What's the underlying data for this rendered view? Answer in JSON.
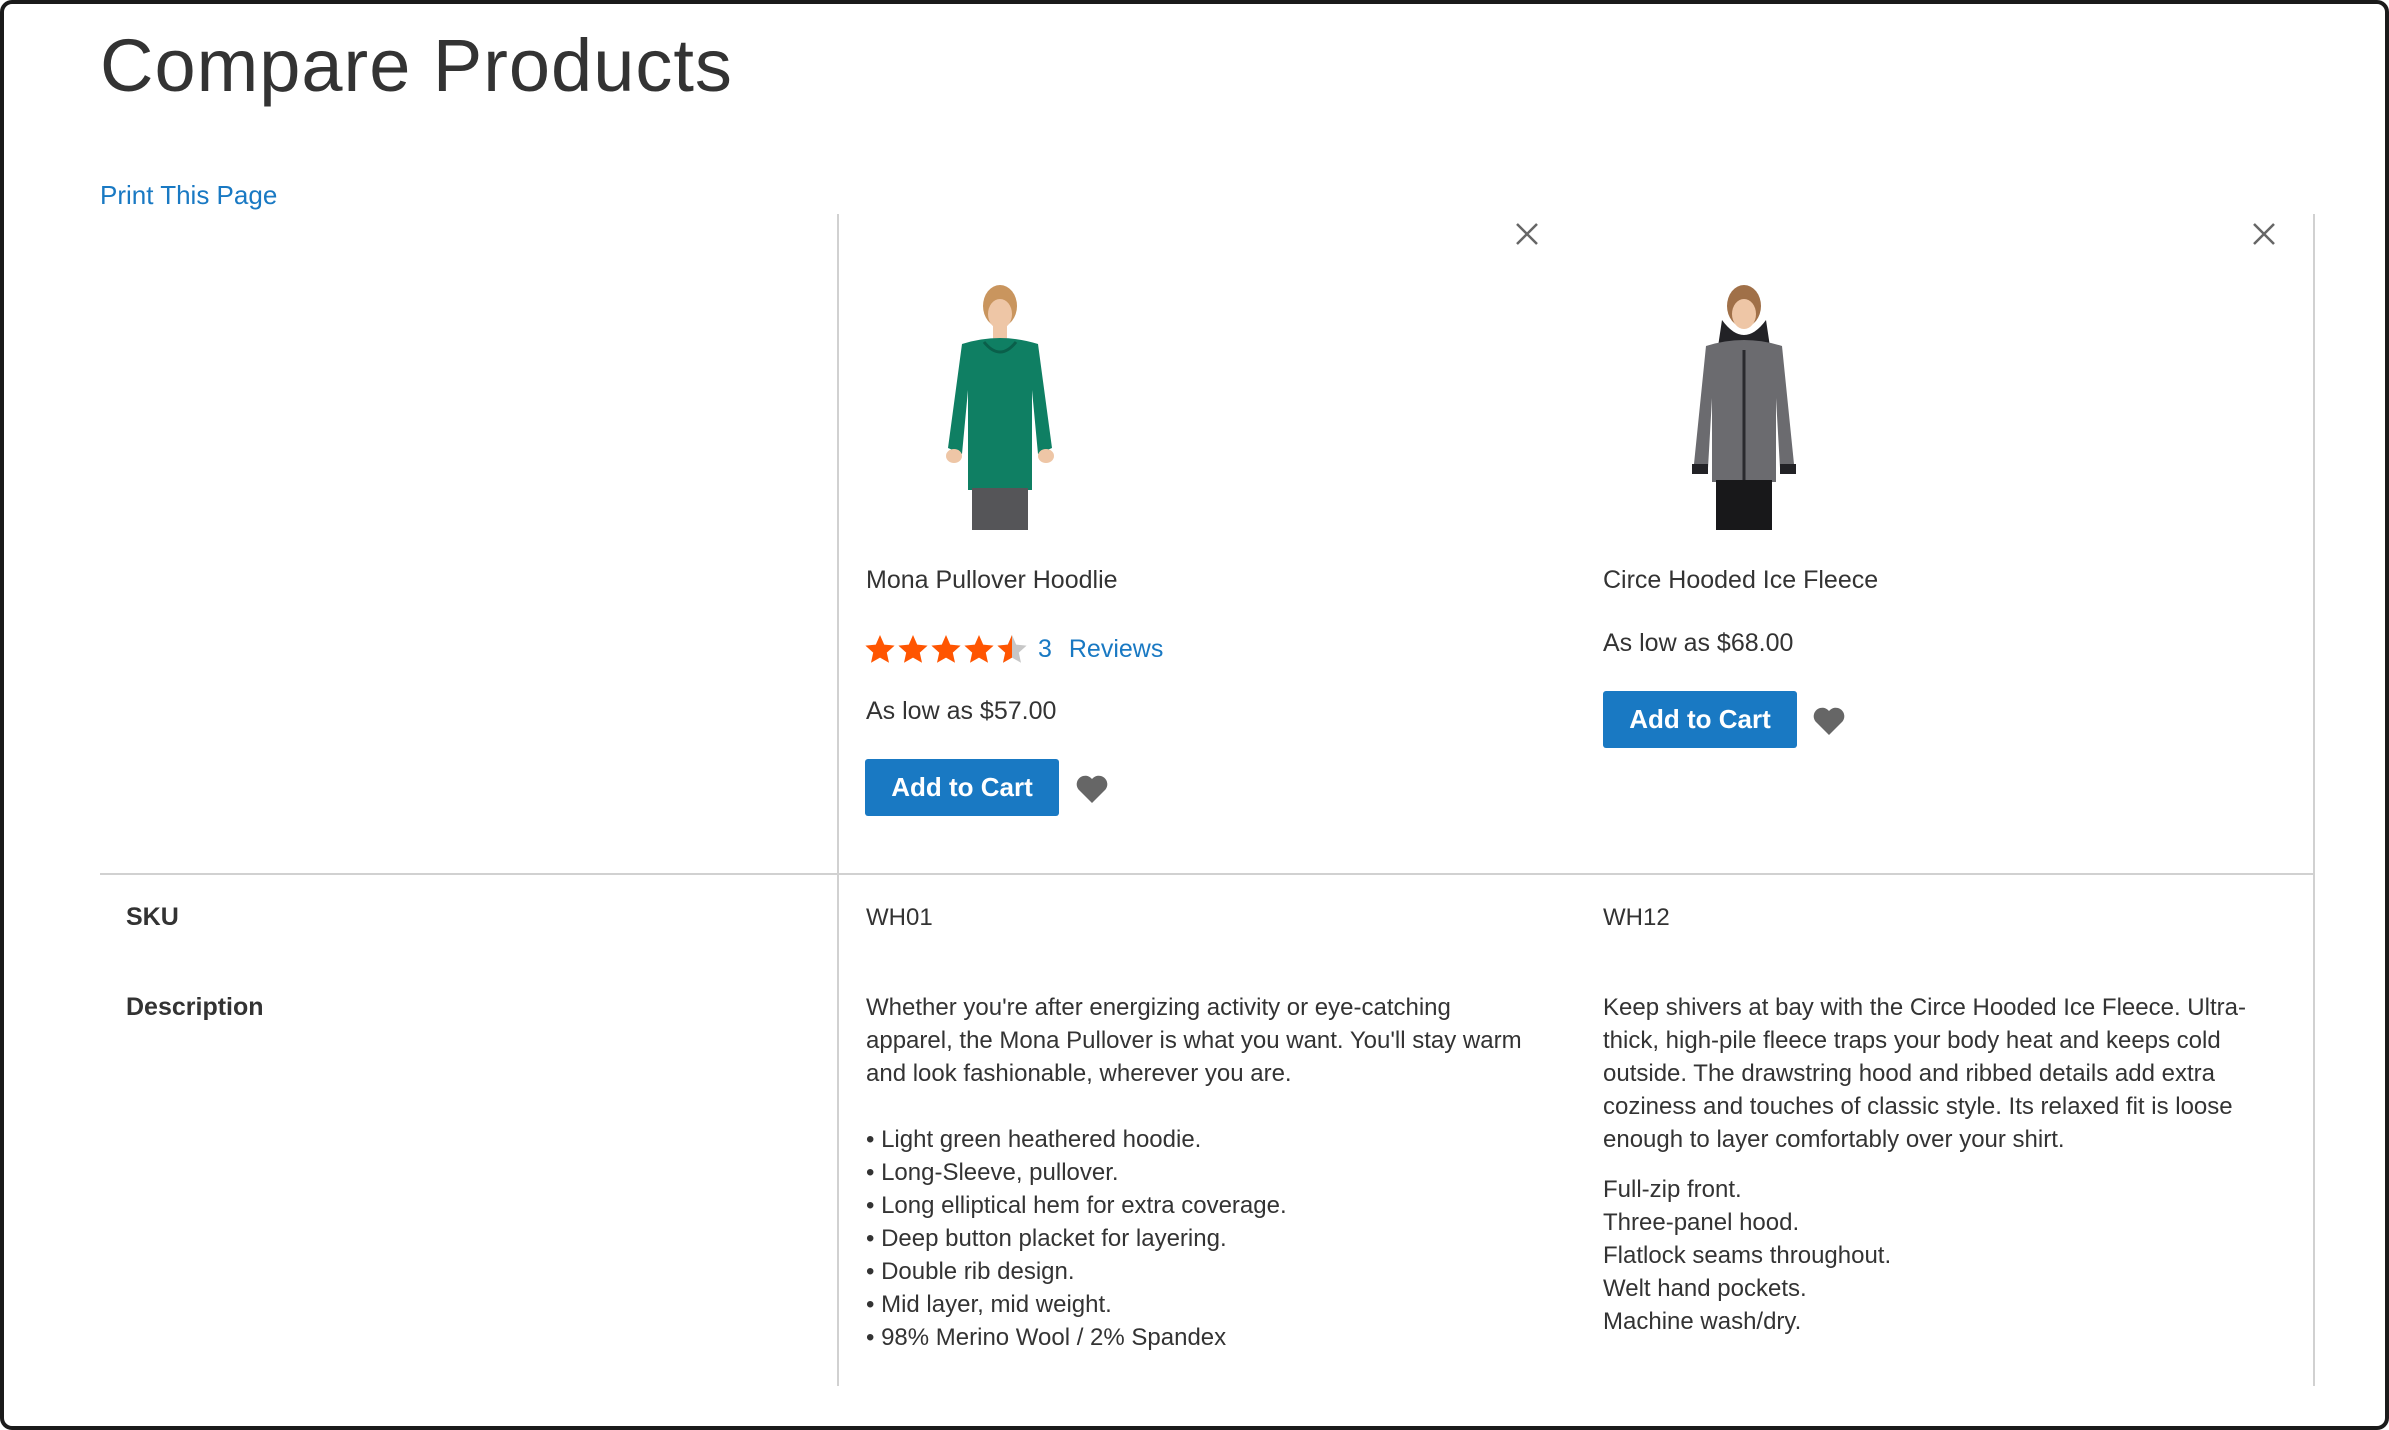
{
  "page": {
    "title": "Compare Products",
    "print_link": "Print This Page",
    "accent_color": "#1979c3",
    "star_color": "#ff5501"
  },
  "products": [
    {
      "name": "Mona Pullover Hoodlie",
      "rating_stars": 4.5,
      "reviews_count": "3",
      "reviews_label": "Reviews",
      "price": "As low as $57.00",
      "add_to_cart": "Add to Cart",
      "sku": "WH01",
      "garment_color": "#0f7f63",
      "description": [
        "Whether you're after energizing activity or eye-catching",
        "apparel, the Mona Pullover is what you want. You'll stay warm",
        "and look fashionable, wherever you are."
      ],
      "features": [
        "• Light green heathered hoodie.",
        "• Long-Sleeve, pullover.",
        "• Long elliptical hem for extra coverage.",
        "• Deep button placket for layering.",
        "• Double rib design.",
        "• Mid layer, mid weight.",
        "• 98% Merino Wool / 2% Spandex"
      ]
    },
    {
      "name": "Circe Hooded Ice Fleece",
      "price": "As low as $68.00",
      "add_to_cart": "Add to Cart",
      "sku": "WH12",
      "garment_color": "#6b6b6f",
      "description": [
        "Keep shivers at bay with the Circe Hooded Ice Fleece. Ultra-",
        "thick, high-pile fleece traps your body heat and keeps cold",
        "outside. The drawstring hood and ribbed details add extra",
        "coziness and touches of classic style. Its relaxed fit is loose",
        "enough to layer comfortably over your shirt."
      ],
      "features": [
        "Full-zip front.",
        "Three-panel hood.",
        "Flatlock seams throughout.",
        "Welt hand pockets.",
        "Machine wash/dry."
      ]
    }
  ],
  "rows": {
    "sku_label": "SKU",
    "description_label": "Description"
  },
  "icons": {
    "remove": "close-icon",
    "wishlist": "heart-icon",
    "rating": "star-icon"
  }
}
